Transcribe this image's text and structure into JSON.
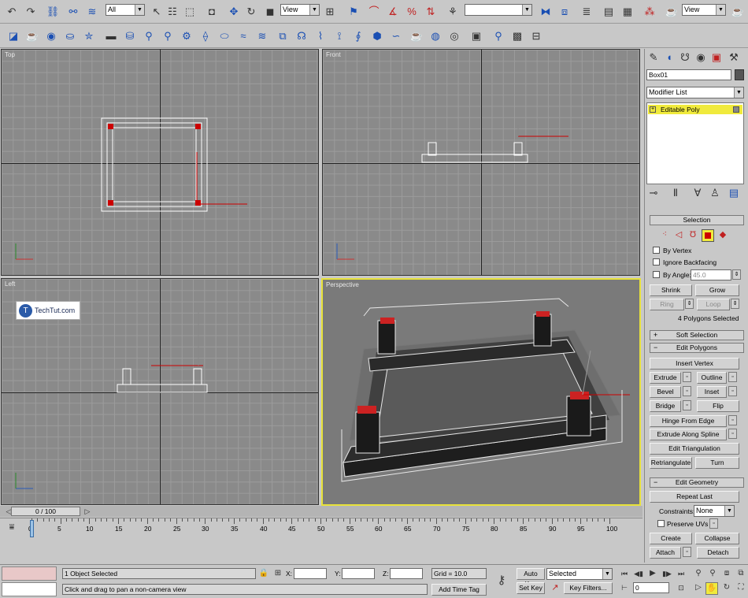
{
  "toolbar_main": {
    "selection_filter": "All",
    "ref_coord": "View",
    "named_sel": "",
    "view_dd": "View"
  },
  "viewports": {
    "top": "Top",
    "front": "Front",
    "left": "Left",
    "perspective": "Perspective"
  },
  "watermark": "TechTut.com",
  "command_panel": {
    "object_name": "Box01",
    "modifier_list": "Modifier List",
    "stack_item": "Editable Poly",
    "selection": {
      "title": "Selection",
      "by_vertex": "By Vertex",
      "ignore_backfacing": "Ignore Backfacing",
      "by_angle": "By Angle:",
      "angle_value": "45.0",
      "shrink": "Shrink",
      "grow": "Grow",
      "ring": "Ring",
      "loop": "Loop",
      "status": "4 Polygons Selected"
    },
    "soft_selection": "Soft Selection",
    "edit_polygons": {
      "title": "Edit Polygons",
      "insert_vertex": "Insert Vertex",
      "extrude": "Extrude",
      "outline": "Outline",
      "bevel": "Bevel",
      "inset": "Inset",
      "bridge": "Bridge",
      "flip": "Flip",
      "hinge": "Hinge From Edge",
      "extrude_spline": "Extrude Along Spline",
      "edit_tri": "Edit Triangulation",
      "retriangulate": "Retriangulate",
      "turn": "Turn"
    },
    "edit_geometry": {
      "title": "Edit Geometry",
      "repeat_last": "Repeat Last",
      "constraints": "Constraints:",
      "constraints_value": "None",
      "preserve_uvs": "Preserve UVs",
      "create": "Create",
      "collapse": "Collapse",
      "attach": "Attach",
      "detach": "Detach"
    }
  },
  "timeline": {
    "frame": "0 / 100",
    "ticks": [
      "0",
      "5",
      "10",
      "15",
      "20",
      "25",
      "30",
      "35",
      "40",
      "45",
      "50",
      "55",
      "60",
      "65",
      "70",
      "75",
      "80",
      "85",
      "90",
      "95",
      "100"
    ]
  },
  "status": {
    "selected": "1 Object Selected",
    "prompt": "Click and drag to pan a non-camera view",
    "x_label": "X:",
    "y_label": "Y:",
    "z_label": "Z:",
    "grid": "Grid = 10.0",
    "add_time_tag": "Add Time Tag",
    "auto_key": "Auto Key",
    "set_key": "Set Key",
    "key_mode": "Selected",
    "key_filters": "Key Filters...",
    "current_frame": "0"
  }
}
